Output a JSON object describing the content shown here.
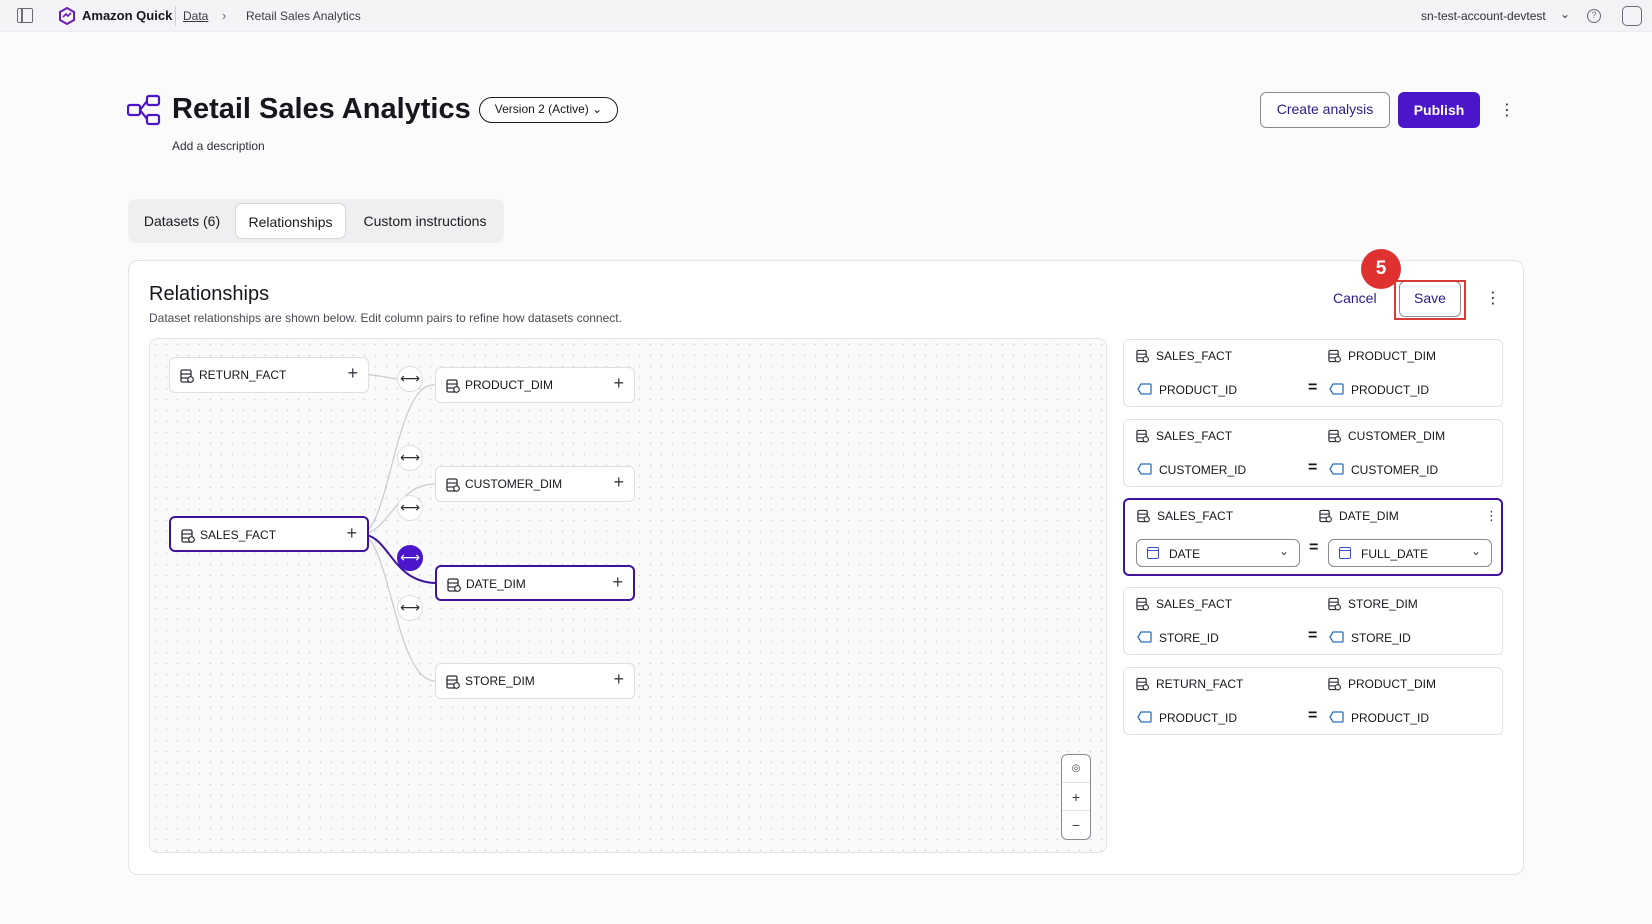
{
  "topbar": {
    "app_name": "Amazon Quick",
    "breadcrumb_data": "Data",
    "breadcrumb_current": "Retail Sales Analytics",
    "account": "sn-test-account-devtest",
    "icons": [
      "sidebar-toggle-icon",
      "quick-logo-icon",
      "chevron-right-icon",
      "chevron-down-icon",
      "help-icon",
      "notification-icon"
    ]
  },
  "header": {
    "title": "Retail Sales Analytics",
    "version": "Version 2 (Active)",
    "description_placeholder": "Add a description",
    "create_analysis": "Create analysis",
    "publish": "Publish",
    "brand_color": "#4b16c9"
  },
  "tabs": [
    {
      "label": "Datasets (6)",
      "selected": false
    },
    {
      "label": "Relationships",
      "selected": true
    },
    {
      "label": "Custom instructions",
      "selected": false
    }
  ],
  "relationships_panel": {
    "title": "Relationships",
    "subtitle": "Dataset relationships are shown below. Edit column pairs to refine how datasets connect.",
    "cancel": "Cancel",
    "save": "Save",
    "step_badge": "5",
    "highlight_color": "#d63a3a"
  },
  "graph": {
    "nodes": [
      {
        "id": "return_fact",
        "label": "RETURN_FACT",
        "active": false
      },
      {
        "id": "product_dim",
        "label": "PRODUCT_DIM",
        "active": false
      },
      {
        "id": "customer_dim",
        "label": "CUSTOMER_DIM",
        "active": false
      },
      {
        "id": "sales_fact",
        "label": "SALES_FACT",
        "active": true
      },
      {
        "id": "date_dim",
        "label": "DATE_DIM",
        "active": true
      },
      {
        "id": "store_dim",
        "label": "STORE_DIM",
        "active": false
      }
    ],
    "zoom_controls": [
      "fit-view-icon",
      "zoom-in-icon",
      "zoom-out-icon"
    ]
  },
  "cards": [
    {
      "left_ds": "SALES_FACT",
      "right_ds": "PRODUCT_DIM",
      "left_col": "PRODUCT_ID",
      "right_col": "PRODUCT_ID",
      "editing": false
    },
    {
      "left_ds": "SALES_FACT",
      "right_ds": "CUSTOMER_DIM",
      "left_col": "CUSTOMER_ID",
      "right_col": "CUSTOMER_ID",
      "editing": false
    },
    {
      "left_ds": "SALES_FACT",
      "right_ds": "DATE_DIM",
      "left_col": "DATE",
      "right_col": "FULL_DATE",
      "editing": true
    },
    {
      "left_ds": "SALES_FACT",
      "right_ds": "STORE_DIM",
      "left_col": "STORE_ID",
      "right_col": "STORE_ID",
      "editing": false
    },
    {
      "left_ds": "RETURN_FACT",
      "right_ds": "PRODUCT_DIM",
      "left_col": "PRODUCT_ID",
      "right_col": "PRODUCT_ID",
      "editing": false
    }
  ],
  "equals_sign": "="
}
